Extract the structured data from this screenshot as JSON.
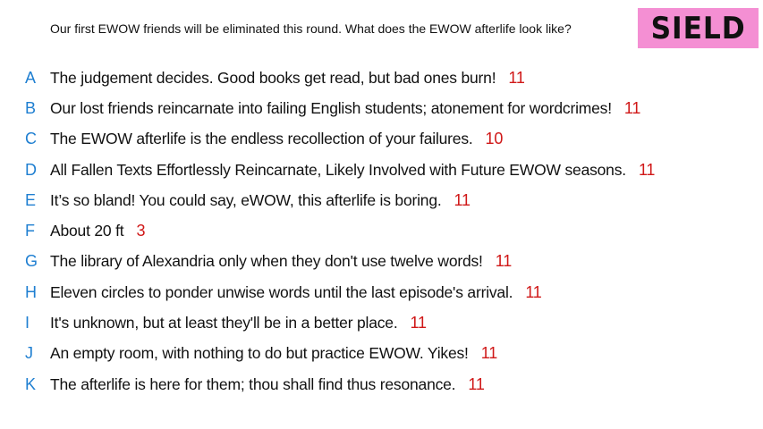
{
  "prompt": "Our first EWOW friends will be eliminated this round. What does the EWOW afterlife look like?",
  "badge": {
    "label": "SIELD",
    "color": "#f48fd3"
  },
  "colors": {
    "letter": "#1f7fd1",
    "score": "#d01818",
    "text": "#111111"
  },
  "responses": [
    {
      "letter": "A",
      "text": "The judgement decides. Good books get read, but bad ones burn!",
      "score": "11"
    },
    {
      "letter": "B",
      "text": "Our lost friends reincarnate into failing English students; atonement for wordcrimes!",
      "score": "11"
    },
    {
      "letter": "C",
      "text": "The EWOW afterlife is the endless recollection of your failures.",
      "score": "10"
    },
    {
      "letter": "D",
      "text": "All Fallen Texts Effortlessly Reincarnate, Likely Involved with Future EWOW seasons.",
      "score": "11"
    },
    {
      "letter": "E",
      "text": "It’s so bland! You could say, eWOW, this afterlife is boring.",
      "score": "11"
    },
    {
      "letter": "F",
      "text": "About 20 ft",
      "score": "3"
    },
    {
      "letter": "G",
      "text": "The library of Alexandria only when they don't use twelve words!",
      "score": "11"
    },
    {
      "letter": "H",
      "text": "Eleven circles to ponder unwise words until the last episode's arrival.",
      "score": "11"
    },
    {
      "letter": "I",
      "text": "It's unknown, but at least they'll be in a better place.",
      "score": "11"
    },
    {
      "letter": "J",
      "text": "An empty room, with nothing to do but practice EWOW. Yikes!",
      "score": "11"
    },
    {
      "letter": "K",
      "text": "The afterlife is here for them; thou shall find thus resonance.",
      "score": "11"
    }
  ]
}
